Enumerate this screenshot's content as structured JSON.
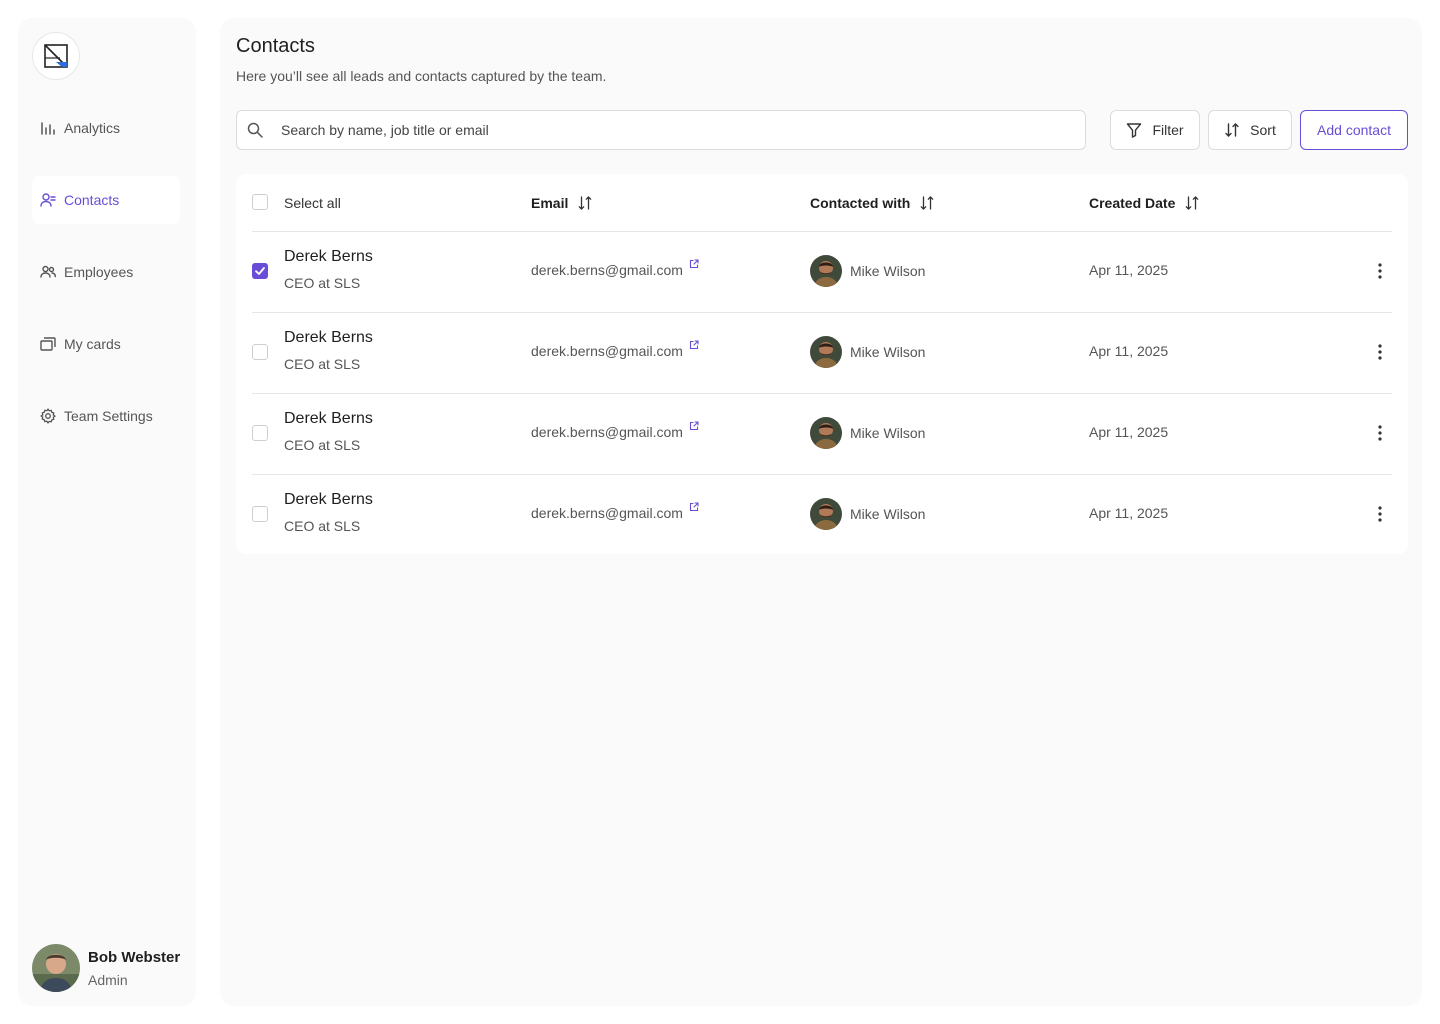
{
  "sidebar": {
    "items": [
      {
        "label": "Analytics",
        "icon": "bar-chart-icon"
      },
      {
        "label": "Contacts",
        "icon": "user-contacts-icon"
      },
      {
        "label": "Employees",
        "icon": "users-icon"
      },
      {
        "label": "My cards",
        "icon": "cards-icon"
      },
      {
        "label": "Team Settings",
        "icon": "gear-icon"
      }
    ],
    "active": "Contacts",
    "profile": {
      "name": "Bob Webster",
      "role": "Admin"
    }
  },
  "header": {
    "title": "Contacts",
    "subtitle": "Here you’ll see all leads and contacts captured by the team."
  },
  "search": {
    "placeholder": "Search by name, job title or email",
    "value": ""
  },
  "toolbar": {
    "filter_label": "Filter",
    "sort_label": "Sort",
    "add_label": "Add contact"
  },
  "table": {
    "select_all_label": "Select all",
    "columns": [
      "Email",
      "Contacted with",
      "Created Date"
    ],
    "rows": [
      {
        "name": "Derek Berns",
        "title": "CEO at SLS",
        "email": "derek.berns@gmail.com",
        "contacted_with": "Mike Wilson",
        "created": "Apr 11, 2025",
        "checked": true
      },
      {
        "name": "Derek Berns",
        "title": "CEO at SLS",
        "email": "derek.berns@gmail.com",
        "contacted_with": "Mike Wilson",
        "created": "Apr 11, 2025",
        "checked": false
      },
      {
        "name": "Derek Berns",
        "title": "CEO at SLS",
        "email": "derek.berns@gmail.com",
        "contacted_with": "Mike Wilson",
        "created": "Apr 11, 2025",
        "checked": false
      },
      {
        "name": "Derek Berns",
        "title": "CEO at SLS",
        "email": "derek.berns@gmail.com",
        "contacted_with": "Mike Wilson",
        "created": "Apr 11, 2025",
        "checked": false
      }
    ]
  },
  "colors": {
    "accent": "#6a4dd6",
    "panel": "#fafafa",
    "border": "#dcdcdc"
  }
}
